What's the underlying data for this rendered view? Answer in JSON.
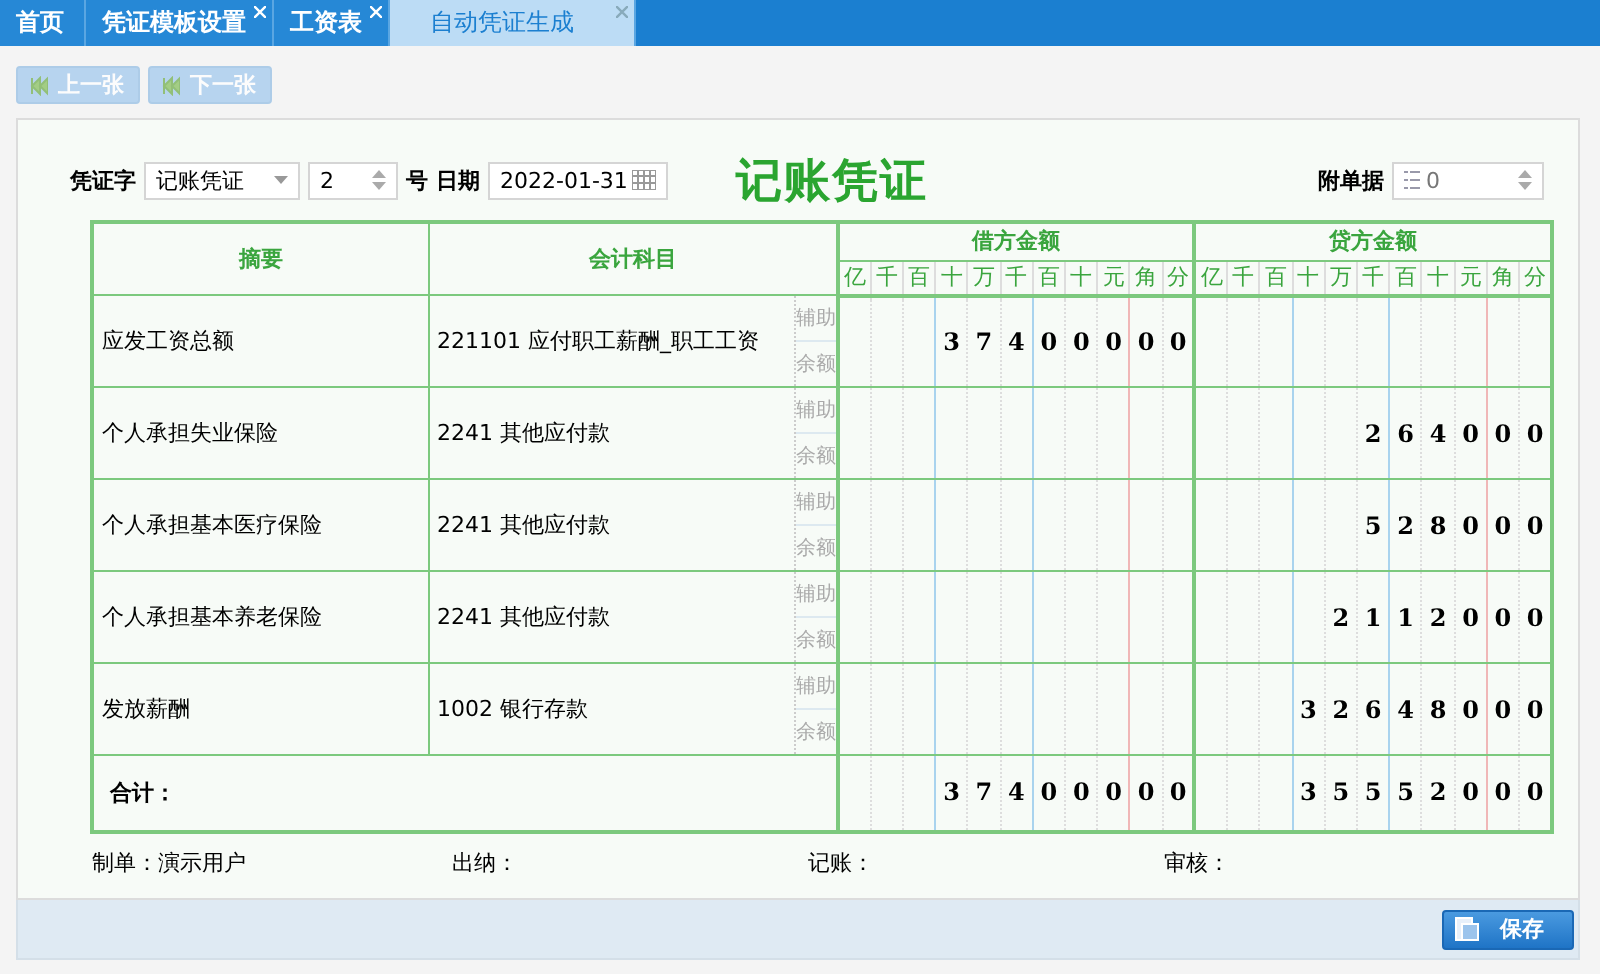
{
  "tabs": [
    {
      "label": "首页",
      "closable": false,
      "selected": false
    },
    {
      "label": "凭证模板设置",
      "closable": true,
      "selected": false
    },
    {
      "label": "工资表",
      "closable": true,
      "selected": false
    },
    {
      "label": "自动凭证生成",
      "closable": true,
      "selected": true
    }
  ],
  "toolbar": {
    "buttons": [
      {
        "label": "上一张",
        "disabled": true
      },
      {
        "label": "下一张",
        "disabled": true
      }
    ]
  },
  "header": {
    "type_label": "凭证字",
    "type_value": "记账凭证",
    "number": "2",
    "number_label": "号",
    "date_label": "日期",
    "date": "2022-01-31",
    "title": "记账凭证",
    "attach_label": "附单据",
    "attach_value": "0"
  },
  "table": {
    "summary_heading": "摘要",
    "subject_heading": "会计科目",
    "debit_heading": "借方金额",
    "credit_heading": "贷方金额",
    "debit_units": [
      "亿",
      "千",
      "百",
      "十",
      "万",
      "千",
      "百",
      "十",
      "元",
      "角",
      "分"
    ],
    "credit_units": [
      "亿",
      "千",
      "百",
      "十",
      "万",
      "千",
      "百",
      "十",
      "元",
      "角",
      "分"
    ],
    "rows": [
      {
        "summary": "应发工资总额",
        "subject": "221101 应付职工薪酬_职工工资",
        "aux": [
          "辅助",
          "余额"
        ],
        "debit": [
          "3",
          "7",
          "4",
          "0",
          "0",
          "0",
          "0",
          "0"
        ],
        "credit": []
      },
      {
        "summary": "个人承担失业保险",
        "subject": "2241 其他应付款",
        "aux": [
          "辅助",
          "余额"
        ],
        "debit": [],
        "credit": [
          "2",
          "6",
          "4",
          "0",
          "0",
          "0"
        ]
      },
      {
        "summary": "个人承担基本医疗保险",
        "subject": "2241 其他应付款",
        "aux": [
          "辅助",
          "余额"
        ],
        "debit": [],
        "credit": [
          "5",
          "2",
          "8",
          "0",
          "0",
          "0"
        ]
      },
      {
        "summary": "个人承担基本养老保险",
        "subject": "2241 其他应付款",
        "aux": [
          "辅助",
          "余额"
        ],
        "debit": [],
        "credit": [
          "2",
          "1",
          "1",
          "2",
          "0",
          "0",
          "0"
        ]
      },
      {
        "summary": "发放薪酬",
        "subject": "1002 银行存款",
        "aux": [
          "辅助",
          "余额"
        ],
        "debit": [],
        "credit": [
          "3",
          "2",
          "6",
          "4",
          "8",
          "0",
          "0",
          "0"
        ]
      }
    ],
    "total": {
      "label": "合计：",
      "debit": [
        "3",
        "7",
        "4",
        "0",
        "0",
        "0",
        "0",
        "0"
      ],
      "credit": [
        "3",
        "5",
        "5",
        "5",
        "2",
        "0",
        "0",
        "0"
      ]
    }
  },
  "signatures": [
    {
      "label": "制单：",
      "value": "演示用户"
    },
    {
      "label": "出纳："
    },
    {
      "label": "记账："
    },
    {
      "label": "审核："
    }
  ],
  "save_button": "保存"
}
